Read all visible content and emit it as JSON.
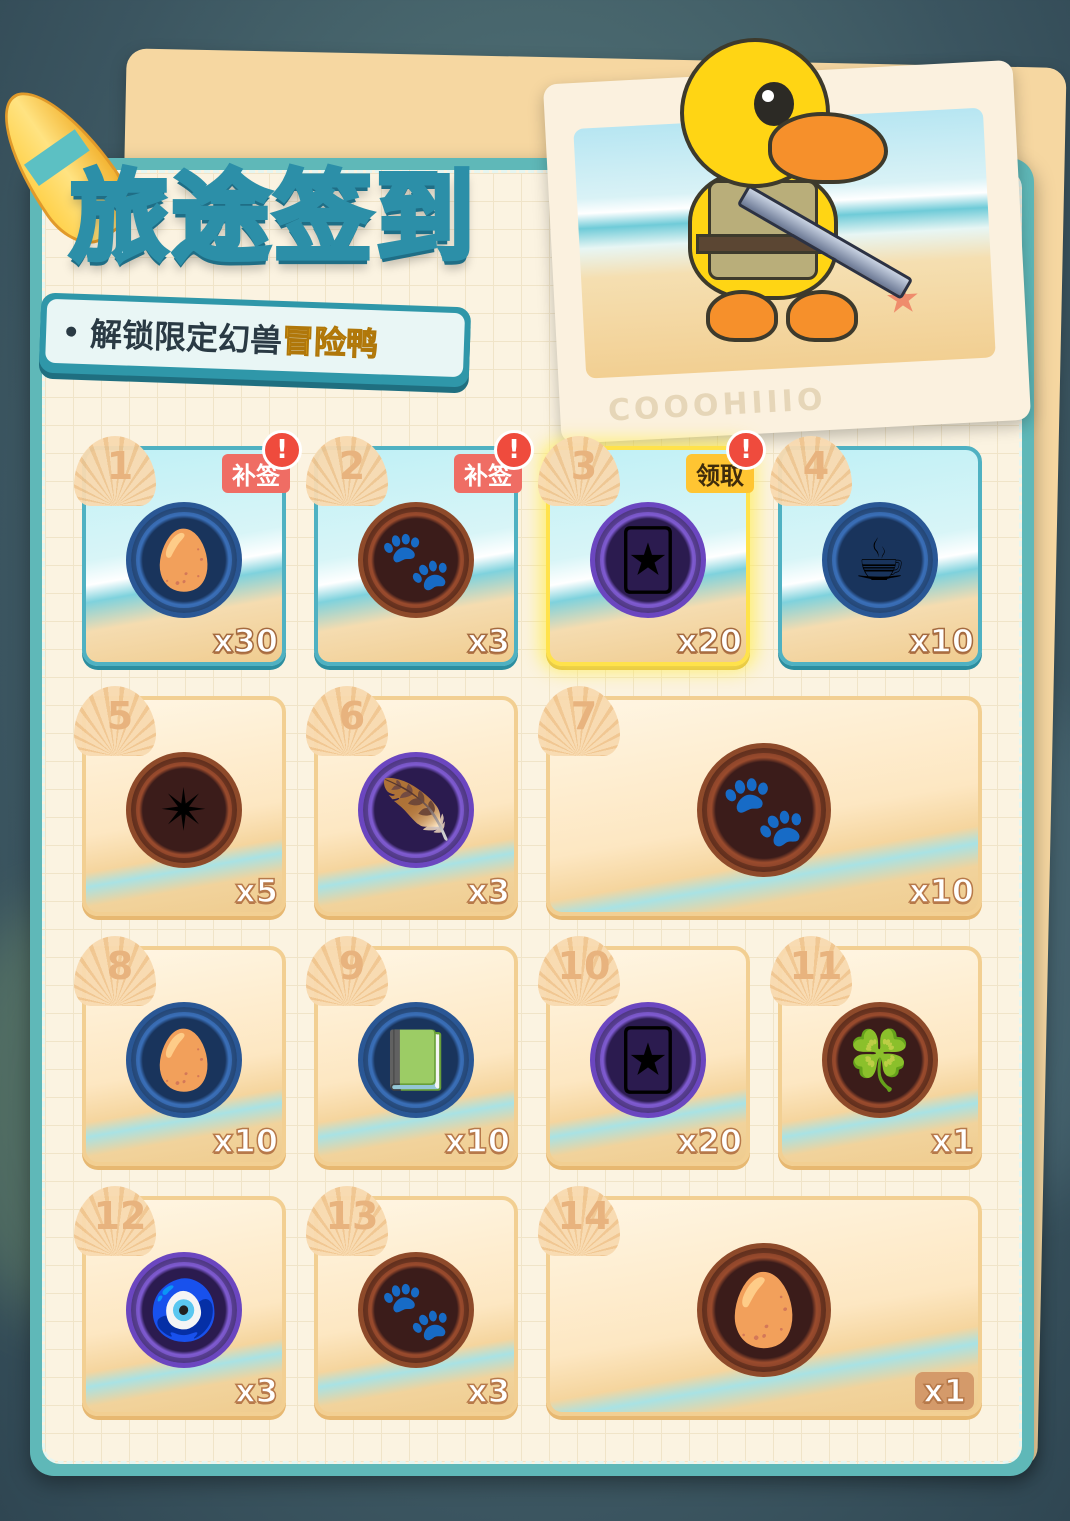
{
  "title": "旅途签到",
  "subtitle": {
    "prefix": "解锁限定幻兽",
    "highlight": "冒险鸭"
  },
  "photo_caption": "COOOHIIIO",
  "colors": {
    "panel": "#5fb8b8",
    "paper": "#fbf3e1",
    "accent_gold": "#ffc532",
    "alert_red": "#ef4b3d"
  },
  "days": [
    {
      "day": "1",
      "qty": "x30",
      "icon": "egg-icon",
      "glyph": "🥚",
      "state": "claimed",
      "tag": "补签",
      "alert": "!"
    },
    {
      "day": "2",
      "qty": "x3",
      "icon": "paw-locket-icon",
      "glyph": "🐾",
      "state": "claimed",
      "tag": "补签",
      "alert": "!"
    },
    {
      "day": "3",
      "qty": "x20",
      "icon": "card-icon",
      "glyph": "🃏",
      "state": "today",
      "tag": "领取",
      "alert": "!"
    },
    {
      "day": "4",
      "qty": "x10",
      "icon": "teacup-icon",
      "glyph": "☕",
      "state": "claimed"
    },
    {
      "day": "5",
      "qty": "x5",
      "icon": "crystal-star-icon",
      "glyph": "✴",
      "state": "locked"
    },
    {
      "day": "6",
      "qty": "x3",
      "icon": "quill-ink-icon",
      "glyph": "🪶",
      "state": "locked"
    },
    {
      "day": "7",
      "qty": "x10",
      "icon": "gold-paw-locket-icon",
      "glyph": "🐾",
      "state": "locked"
    },
    {
      "day": "8",
      "qty": "x10",
      "icon": "egg-icon",
      "glyph": "🥚",
      "state": "locked"
    },
    {
      "day": "9",
      "qty": "x10",
      "icon": "book-icon",
      "glyph": "📗",
      "state": "locked"
    },
    {
      "day": "10",
      "qty": "x20",
      "icon": "card-icon",
      "glyph": "🃏",
      "state": "locked"
    },
    {
      "day": "11",
      "qty": "x1",
      "icon": "clover-ticket-icon",
      "glyph": "🍀",
      "state": "locked"
    },
    {
      "day": "12",
      "qty": "x3",
      "icon": "jade-pendant-icon",
      "glyph": "🧿",
      "state": "locked"
    },
    {
      "day": "13",
      "qty": "x3",
      "icon": "paw-locket-icon",
      "glyph": "🐾",
      "state": "locked"
    },
    {
      "day": "14",
      "qty": "x1",
      "icon": "duck-egg-icon",
      "glyph": "🥚",
      "state": "locked"
    }
  ]
}
